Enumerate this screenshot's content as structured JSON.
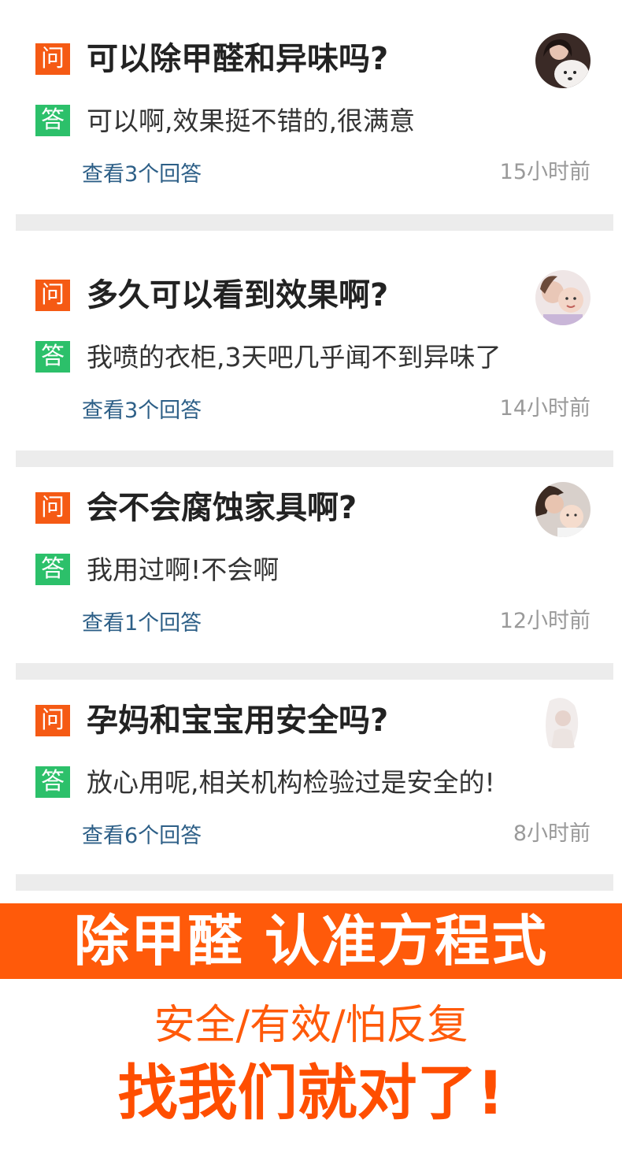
{
  "badges": {
    "question": "问",
    "answer": "答"
  },
  "items": [
    {
      "question": "可以除甲醛和异味吗?",
      "answer": "可以啊,效果挺不错的,很满意",
      "more": "查看3个回答",
      "time": "15小时前",
      "avatar": "woman-with-dog-avatar"
    },
    {
      "question": "多久可以看到效果啊?",
      "answer": "我喷的衣柜,3天吧几乎闻不到异味了",
      "more": "查看3个回答",
      "time": "14小时前",
      "avatar": "mother-and-child-avatar"
    },
    {
      "question": "会不会腐蚀家具啊?",
      "answer": "我用过啊!不会啊",
      "more": "查看1个回答",
      "time": "12小时前",
      "avatar": "mother-and-baby-avatar"
    },
    {
      "question": "孕妈和宝宝用安全吗?",
      "answer": "放心用呢,相关机构检验过是安全的!",
      "more": "查看6个回答",
      "time": "8小时前",
      "avatar": "bride-silhouette-avatar"
    }
  ],
  "banner": "除甲醛  认准方程式",
  "slogan_line1": "安全/有效/怕反复",
  "slogan_line2": "找我们就对了!",
  "colors": {
    "orange": "#ff5a0a",
    "green": "#2cc06a",
    "link": "#2d5f87",
    "divider": "#ececec"
  }
}
